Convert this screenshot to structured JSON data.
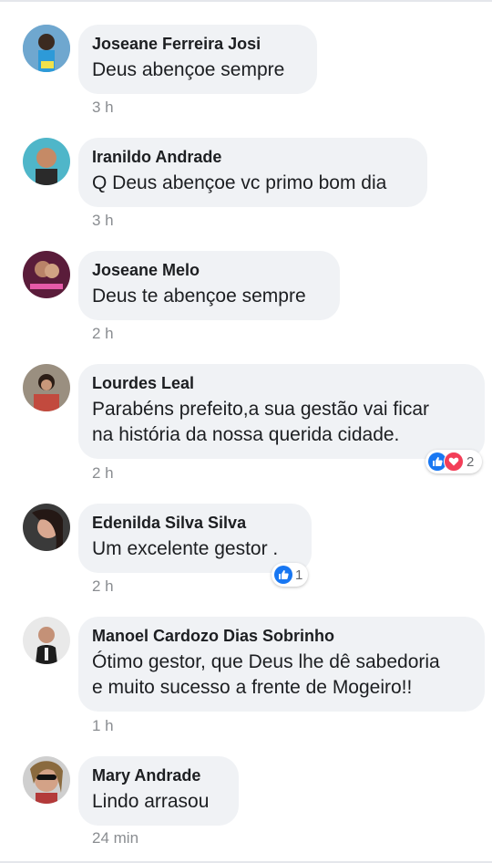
{
  "comments": [
    {
      "name": "Joseane Ferreira Josi",
      "text": "Deus abençoe sempre",
      "time": "3 h"
    },
    {
      "name": "Iranildo Andrade",
      "text": "Q Deus abençoe vc primo bom dia",
      "time": "3 h"
    },
    {
      "name": "Joseane Melo",
      "text": "Deus te abençoe sempre",
      "time": "2 h"
    },
    {
      "name": "Lourdes Leal",
      "text": "Parabéns prefeito,a sua gestão vai ficar\nna história da nossa querida cidade.",
      "time": "2 h",
      "reactions": {
        "types": [
          "like",
          "love"
        ],
        "count": "2"
      }
    },
    {
      "name": "Edenilda Silva Silva",
      "text": "Um excelente gestor .",
      "time": "2 h",
      "reactions": {
        "types": [
          "like"
        ],
        "count": "1"
      }
    },
    {
      "name": "Manoel Cardozo Dias Sobrinho",
      "text": "Ótimo gestor, que Deus lhe dê  sabedoria\ne muito sucesso a frente de Mogeiro!!",
      "time": "1 h"
    },
    {
      "name": "Mary Andrade",
      "text": "Lindo arrasou",
      "time": "24 min"
    }
  ],
  "colors": {
    "bubble": "#f0f2f5",
    "like": "#1877f2",
    "love": "#f33e58",
    "timestamp": "#8a8d91"
  },
  "icons": {
    "like": "thumbs-up-icon",
    "love": "heart-icon"
  }
}
